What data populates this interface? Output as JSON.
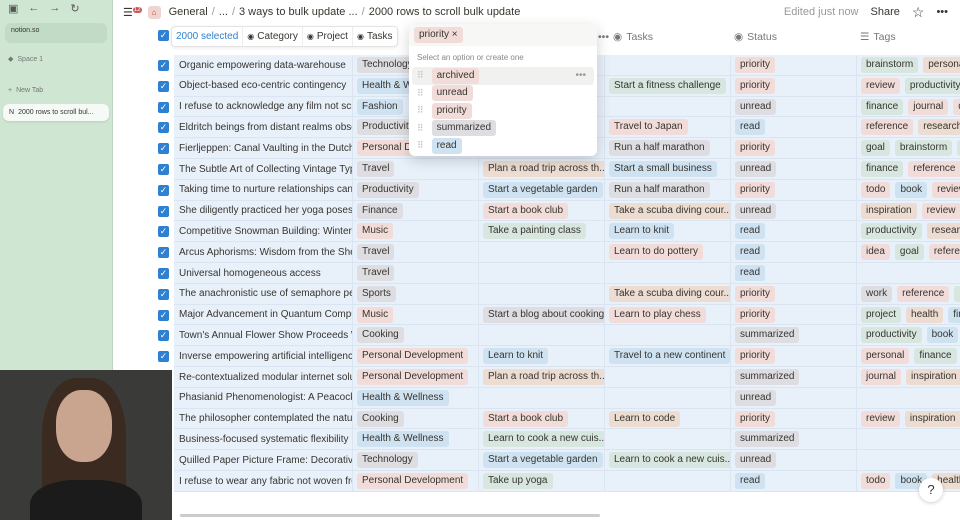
{
  "sidebar": {
    "url": "notion.so",
    "space": "Space 1",
    "new_tab": "New Tab",
    "active_tab": "2000 rows to scroll bul...",
    "notification_count": "12"
  },
  "topbar": {
    "breadcrumbs": [
      "General",
      "...",
      "3 ways to bulk update ...",
      "2000 rows to scroll bulk update"
    ],
    "edited": "Edited just now",
    "share": "Share"
  },
  "bulk": {
    "selected": "2000 selected",
    "category": "Category",
    "project": "Project",
    "tasks": "Tasks"
  },
  "headers": {
    "tasks": "Tasks",
    "status": "Status",
    "tags": "Tags"
  },
  "dropdown": {
    "chip": "priority",
    "hint": "Select an option or create one",
    "options": [
      {
        "label": "archived",
        "color": "pink"
      },
      {
        "label": "unread",
        "color": "pink"
      },
      {
        "label": "priority",
        "color": "pink"
      },
      {
        "label": "summarized",
        "color": "gray"
      },
      {
        "label": "read",
        "color": "blue"
      }
    ]
  },
  "colors": {
    "accent": "#2f80d1",
    "row_selected": "#e8f0fa",
    "sidebar": "#cfe6d3"
  },
  "rows": [
    {
      "title": "Organic empowering data-warehouse",
      "category": "Technology",
      "project": "",
      "task": "",
      "status": "priority",
      "tags": [
        "brainstorm",
        "persona"
      ]
    },
    {
      "title": "Object-based eco-centric contingency",
      "category": "Health & Wellness",
      "project": "",
      "task": "Start a fitness challenge",
      "status": "priority",
      "tags": [
        "review",
        "productivity"
      ]
    },
    {
      "title": "I refuse to acknowledge any film not screened",
      "category": "Fashion",
      "project": "",
      "task": "",
      "status": "unread",
      "tags": [
        "finance",
        "journal",
        "q"
      ]
    },
    {
      "title": "Eldritch beings from distant realms observe",
      "category": "Productivity",
      "project": "",
      "task": "Travel to Japan",
      "status": "read",
      "tags": [
        "reference",
        "research"
      ]
    },
    {
      "title": "Fierljeppen: Canal Vaulting in the Dutch Countryside",
      "category": "Personal Development",
      "project": "",
      "task": "Run a half marathon",
      "status": "priority",
      "tags": [
        "goal",
        "brainstorm",
        "r"
      ]
    },
    {
      "title": "The Subtle Art of Collecting Vintage Typewriters",
      "category": "Travel",
      "project": "Plan a road trip across th...",
      "task": "Start a small business",
      "status": "unread",
      "tags": [
        "finance",
        "reference"
      ]
    },
    {
      "title": "Taking time to nurture relationships can improve",
      "category": "Productivity",
      "project": "Start a vegetable garden",
      "task": "Run a half marathon",
      "status": "priority",
      "tags": [
        "todo",
        "book",
        "review"
      ]
    },
    {
      "title": "She diligently practiced her yoga poses every",
      "category": "Finance",
      "project": "Start a book club",
      "task": "Take a scuba diving cour...",
      "status": "unread",
      "tags": [
        "inspiration",
        "review"
      ]
    },
    {
      "title": "Competitive Snowman Building: Winter Sports",
      "category": "Music",
      "project": "Take a painting class",
      "task": "Learn to knit",
      "status": "read",
      "tags": [
        "productivity",
        "research"
      ]
    },
    {
      "title": "Arcus Aphorisms: Wisdom from the Shelf",
      "category": "Travel",
      "project": "",
      "task": "Learn to do pottery",
      "status": "read",
      "tags": [
        "idea",
        "goal",
        "reference"
      ]
    },
    {
      "title": "Universal homogeneous access",
      "category": "Travel",
      "project": "",
      "task": "",
      "status": "read",
      "tags": []
    },
    {
      "title": "The anachronistic use of semaphore persists",
      "category": "Sports",
      "project": "",
      "task": "Take a scuba diving cour...",
      "status": "priority",
      "tags": [
        "work",
        "reference",
        "le"
      ]
    },
    {
      "title": "Major Advancement in Quantum Computing",
      "category": "Music",
      "project": "Start a blog about cooking",
      "task": "Learn to play chess",
      "status": "priority",
      "tags": [
        "project",
        "health",
        "fin"
      ]
    },
    {
      "title": "Town's Annual Flower Show Proceeds Without",
      "category": "Cooking",
      "project": "",
      "task": "",
      "status": "summarized",
      "tags": [
        "productivity",
        "book"
      ]
    },
    {
      "title": "Inverse empowering artificial intelligence",
      "category": "Personal Development",
      "project": "Learn to knit",
      "task": "Travel to a new continent",
      "status": "priority",
      "tags": [
        "personal",
        "finance"
      ]
    },
    {
      "title": "Re-contextualized modular internet solution",
      "category": "Personal Development",
      "project": "Plan a road trip across th...",
      "task": "",
      "status": "summarized",
      "tags": [
        "journal",
        "inspiration"
      ]
    },
    {
      "title": "Phasianid Phenomenologist: A Peacock's",
      "category": "Health & Wellness",
      "project": "",
      "task": "",
      "status": "unread",
      "tags": []
    },
    {
      "title": "The philosopher contemplated the nature",
      "category": "Cooking",
      "project": "Start a book club",
      "task": "Learn to code",
      "status": "priority",
      "tags": [
        "review",
        "inspiration"
      ]
    },
    {
      "title": "Business-focused systematic flexibility",
      "category": "Health & Wellness",
      "project": "Learn to cook a new cuis...",
      "task": "",
      "status": "summarized",
      "tags": []
    },
    {
      "title": "Quilled Paper Picture Frame: Decorative Edges",
      "category": "Technology",
      "project": "Start a vegetable garden",
      "task": "Learn to cook a new cuis...",
      "status": "unread",
      "tags": []
    },
    {
      "title": "I refuse to wear any fabric not woven from",
      "category": "Personal Development",
      "project": "Take up yoga",
      "task": "",
      "status": "read",
      "tags": [
        "todo",
        "book",
        "health"
      ]
    }
  ]
}
